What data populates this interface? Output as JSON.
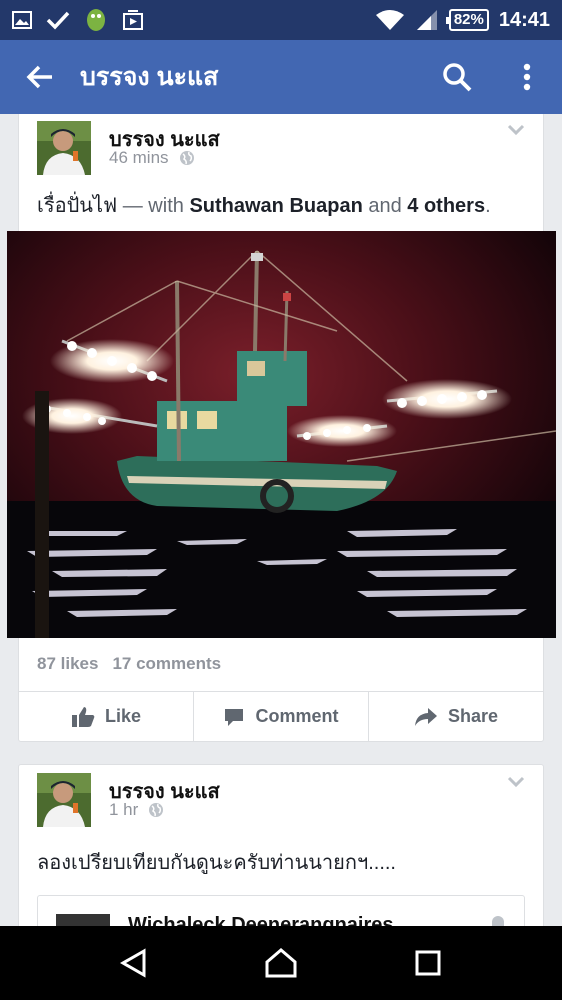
{
  "status_bar": {
    "battery": "82%",
    "time": "14:41",
    "icons": [
      "image-icon",
      "check-icon",
      "android-icon",
      "media-icon",
      "wifi-icon",
      "signal-icon",
      "battery-icon"
    ]
  },
  "app_bar": {
    "title": "บรรจง นะแส",
    "icons": [
      "back-arrow-icon",
      "search-icon",
      "more-vert-icon"
    ]
  },
  "posts": [
    {
      "author": "บรรจง นะแส",
      "time": "46 mins",
      "text_main": "เรื่อปั่นไฟ",
      "text_with": " — with ",
      "tagged_1": "Suthawan Buapan",
      "text_and": " and ",
      "tagged_2": "4 others",
      "text_end": ".",
      "likes": "87 likes",
      "comments": "17 comments",
      "actions": {
        "like": "Like",
        "comment": "Comment",
        "share": "Share"
      }
    },
    {
      "author": "บรรจง นะแส",
      "time": "1 hr",
      "text": "ลองเปรียบเทียบกันดูนะครับท่านนายกฯ.....",
      "shared_author": "Wichaleck Deenerangnaires"
    }
  ],
  "colors": {
    "status_bar": "#23386a",
    "app_bar": "#4267b2",
    "feed_bg": "#e9ebee",
    "muted_text": "#90949c"
  },
  "nav_bar": {
    "icons": [
      "back-nav-icon",
      "home-nav-icon",
      "recents-nav-icon"
    ]
  }
}
